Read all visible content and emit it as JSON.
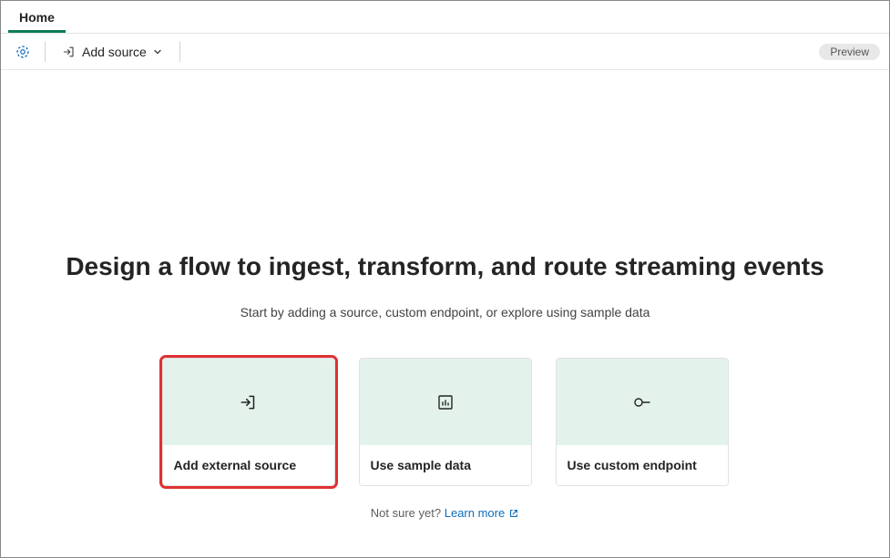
{
  "tabs": {
    "home": "Home"
  },
  "toolbar": {
    "add_source_label": "Add source",
    "preview_label": "Preview"
  },
  "main": {
    "title": "Design a flow to ingest, transform, and route streaming events",
    "subtitle": "Start by adding a source, custom endpoint, or explore using sample data",
    "cards": [
      {
        "label": "Add external source"
      },
      {
        "label": "Use sample data"
      },
      {
        "label": "Use custom endpoint"
      }
    ],
    "footer_prompt": "Not sure yet?",
    "learn_more_label": "Learn more"
  }
}
